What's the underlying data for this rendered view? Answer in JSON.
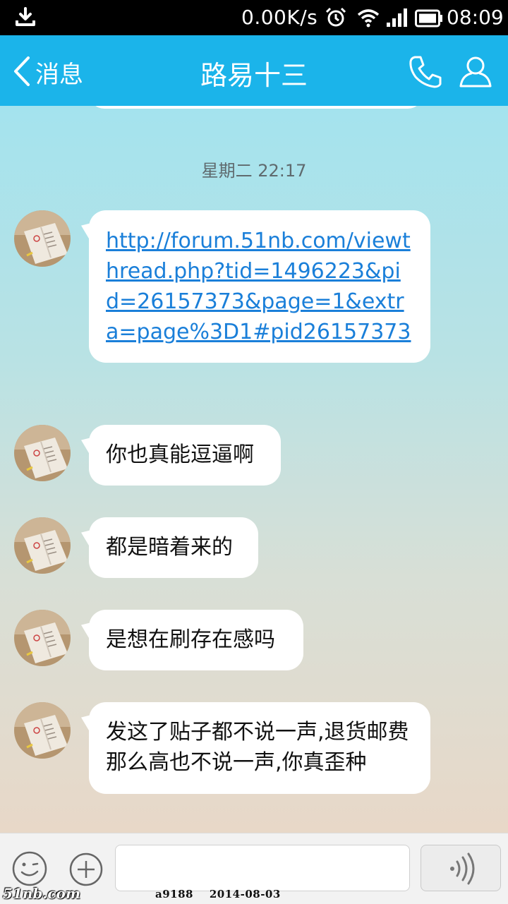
{
  "status_bar": {
    "network_speed": "0.00K/s",
    "time": "08:09",
    "icons": [
      "download-icon",
      "alarm-icon",
      "wifi-icon",
      "signal-icon",
      "battery-icon"
    ]
  },
  "header": {
    "back_label": "消息",
    "title": "路易十三",
    "icons": [
      "back-chevron-icon",
      "phone-icon",
      "profile-icon"
    ]
  },
  "chat": {
    "timestamp": "星期二 22:17",
    "messages": [
      {
        "type": "link",
        "text": "http://forum.51nb.com/viewthread.php?tid=1496223&pid=26157373&page=1&extra=page%3D1#pid26157373"
      },
      {
        "type": "text",
        "text": "你也真能逗逼啊"
      },
      {
        "type": "text",
        "text": "都是暗着来的"
      },
      {
        "type": "text",
        "text": "是想在刷存在感吗"
      },
      {
        "type": "text",
        "text": "发这了贴子都不说一声,退货邮费那么高也不说一声,你真歪种"
      }
    ]
  },
  "input_bar": {
    "icons": [
      "emoji-icon",
      "plus-icon",
      "voice-icon"
    ],
    "text_value": ""
  },
  "watermark": {
    "logo": "51nb.com",
    "text": "a9188    2014-08-03"
  },
  "colors": {
    "header_bg": "#1bb4ea",
    "link": "#1a7fd9"
  }
}
